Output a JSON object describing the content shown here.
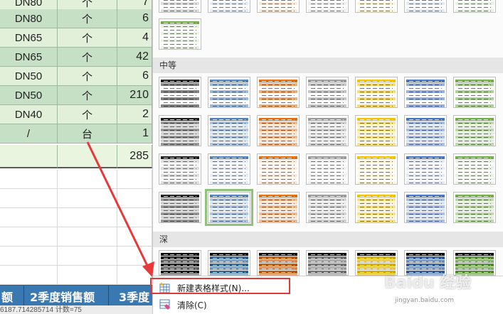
{
  "sheet": {
    "rows": [
      {
        "a": "DN80",
        "b": "个",
        "c": "7"
      },
      {
        "a": "DN80",
        "b": "个",
        "c": "6"
      },
      {
        "a": "DN65",
        "b": "个",
        "c": "4"
      },
      {
        "a": "DN65",
        "b": "个",
        "c": "42"
      },
      {
        "a": "DN50",
        "b": "个",
        "c": "6"
      },
      {
        "a": "DN50",
        "b": "个",
        "c": "210"
      },
      {
        "a": "DN40",
        "b": "个",
        "c": "2"
      },
      {
        "a": "/",
        "b": "台",
        "c": "1"
      },
      {
        "a": "",
        "b": "",
        "c": "285"
      }
    ],
    "colors": {
      "band_dark": "#c6e0c6",
      "band_light": "#e2f0da",
      "total_row": "#eaf5e0"
    }
  },
  "tabs": [
    {
      "label": "额"
    },
    {
      "label": "2季度销售额"
    },
    {
      "label": "3季度"
    }
  ],
  "status": {
    "text": "6187.714285714  计数=75"
  },
  "gallery": {
    "sections": [
      {
        "label": "中等"
      },
      {
        "label": "深"
      }
    ],
    "light_colors": [
      "#222222",
      "#222222",
      "#4f81bd",
      "#e46c0a",
      "#9a9a9a",
      "#f2c200",
      "#4472c4",
      "#70ad47"
    ],
    "medium_colors": [
      "#1f1f1f",
      "#4f81bd",
      "#e46c0a",
      "#9a9a9a",
      "#f2c200",
      "#4472c4",
      "#70ad47"
    ],
    "dark_colors": [
      "#111111",
      "#2e5f96",
      "#c0520a",
      "#6e6e6e",
      "#d9a800",
      "#2f56a0",
      "#4f8a2f"
    ]
  },
  "menu": {
    "new_style": "新建表格样式(N)...",
    "clear": "清除(C)"
  },
  "watermark": {
    "text": "Baidu 经验",
    "url": "jingyan.baidu.com"
  }
}
